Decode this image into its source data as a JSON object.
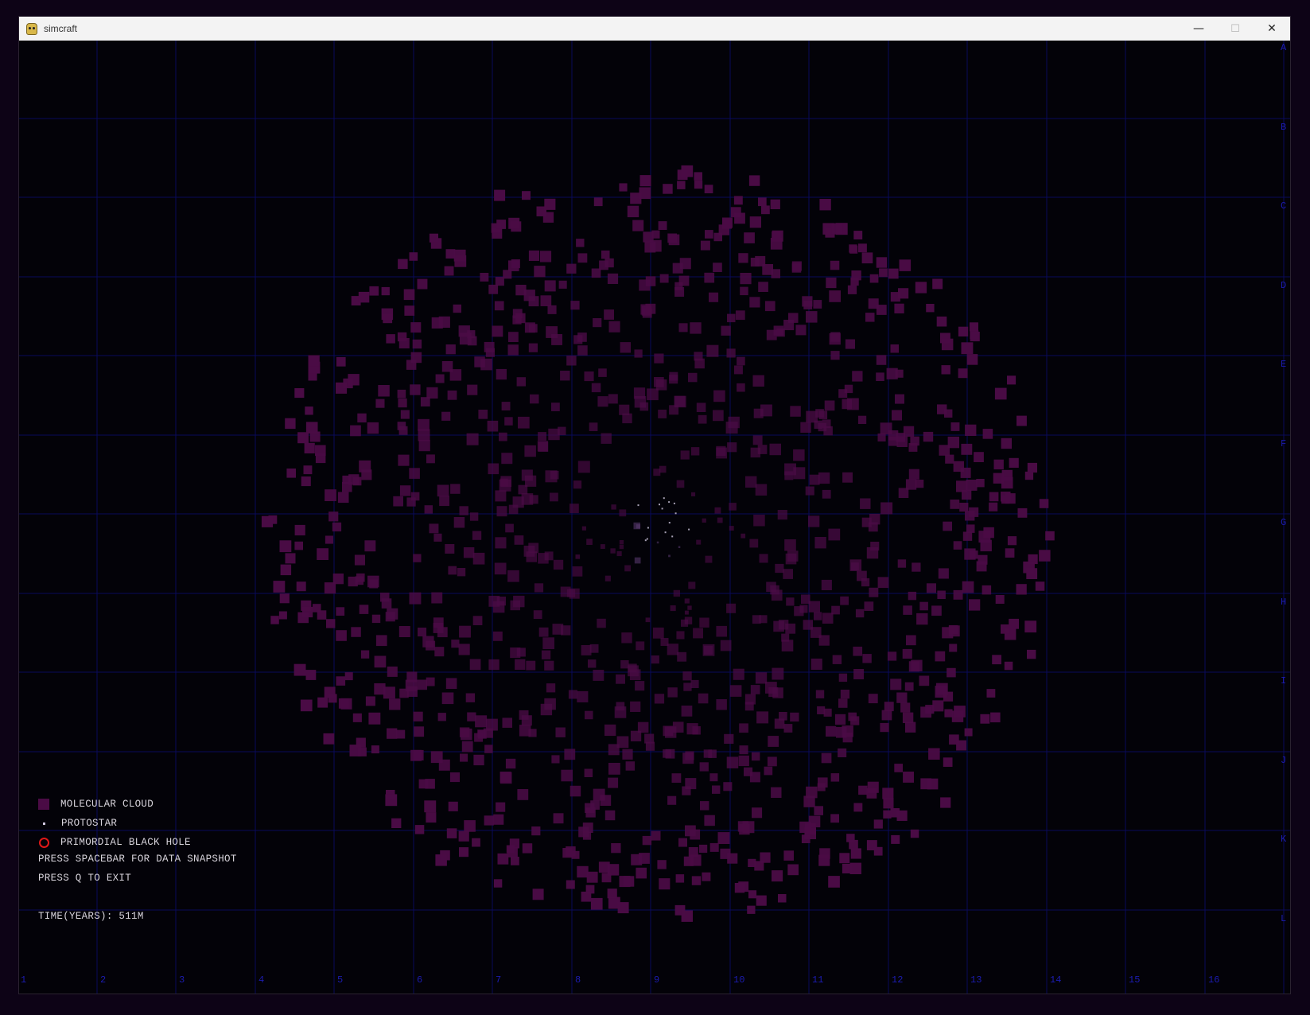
{
  "window": {
    "title": "simcraft",
    "icon": "pygame-snake-icon",
    "controls": {
      "minimize": "—",
      "maximize": "☐",
      "close": "✕"
    }
  },
  "grid": {
    "color": "#0a0a5a",
    "label_color": "#1c1cb0",
    "columns": [
      "1",
      "2",
      "3",
      "4",
      "5",
      "6",
      "7",
      "8",
      "9",
      "10",
      "11",
      "12",
      "13",
      "14",
      "15",
      "16"
    ],
    "rows": [
      "A",
      "B",
      "C",
      "D",
      "E",
      "F",
      "G",
      "H",
      "I",
      "J",
      "K",
      "L"
    ]
  },
  "legend": {
    "molecular_cloud": "MOLECULAR CLOUD",
    "protostar": "PROTOSTAR",
    "primordial_black_hole": "PRIMORDIAL BLACK HOLE"
  },
  "colors": {
    "molecular_cloud": "#4a0b45",
    "protostar": "#d0c8e0",
    "black_hole": "#e01818"
  },
  "instructions": {
    "snapshot": "PRESS SPACEBAR FOR DATA SNAPSHOT",
    "exit": "PRESS Q TO EXIT"
  },
  "status": {
    "time": "TIME(YEARS): 511M"
  }
}
